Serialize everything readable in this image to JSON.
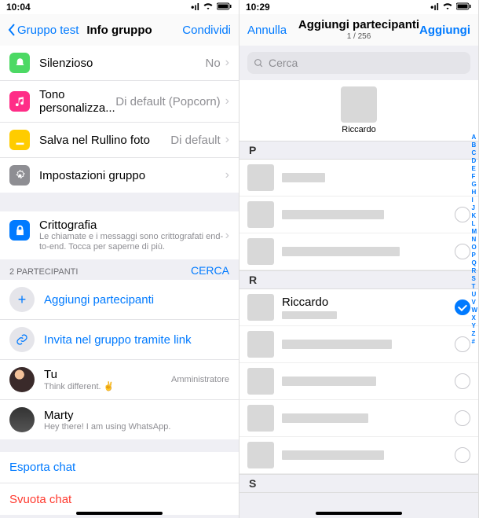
{
  "left": {
    "status_time": "10:04",
    "nav_back": "Gruppo test",
    "nav_title": "Info gruppo",
    "nav_share": "Condividi",
    "settings": [
      {
        "label": "Silenzioso",
        "value": "No",
        "icon": "bell",
        "color": "green"
      },
      {
        "label": "Tono personalizza...",
        "value": "Di default (Popcorn)",
        "icon": "music",
        "color": "pink"
      },
      {
        "label": "Salva nel Rullino foto",
        "value": "Di default",
        "icon": "download",
        "color": "yellow"
      },
      {
        "label": "Impostazioni gruppo",
        "value": "",
        "icon": "gear",
        "color": "gray"
      }
    ],
    "encryption": {
      "title": "Crittografia",
      "sub": "Le chiamate e i messaggi sono crittografati end-to-end. Tocca per saperne di più."
    },
    "participants_header": "2 PARTECIPANTI",
    "cerca": "CERCA",
    "add_participants": "Aggiungi partecipanti",
    "invite_link": "Invita nel gruppo tramite link",
    "members": [
      {
        "name": "Tu",
        "status": "Think different. ✌️",
        "role": "Amministratore"
      },
      {
        "name": "Marty",
        "status": "Hey there! I am using WhatsApp.",
        "role": ""
      }
    ],
    "export": "Esporta chat",
    "clear": "Svuota chat"
  },
  "right": {
    "status_time": "10:29",
    "nav_cancel": "Annulla",
    "nav_title": "Aggiungi partecipanti",
    "nav_sub": "1 / 256",
    "nav_add": "Aggiungi",
    "search_placeholder": "Cerca",
    "selected_name": "Riccardo",
    "section_P": "P",
    "section_R": "R",
    "section_S": "S",
    "r_contact_name": "Riccardo",
    "alpha": [
      "A",
      "B",
      "C",
      "D",
      "E",
      "F",
      "G",
      "H",
      "I",
      "J",
      "K",
      "L",
      "M",
      "N",
      "O",
      "P",
      "Q",
      "R",
      "S",
      "T",
      "U",
      "V",
      "W",
      "X",
      "Y",
      "Z",
      "#"
    ]
  }
}
